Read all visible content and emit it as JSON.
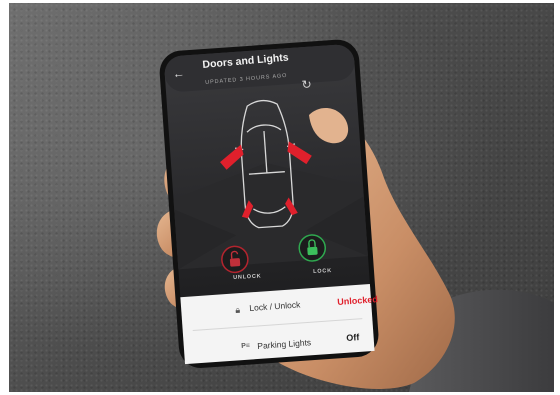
{
  "app": {
    "back_icon": "←",
    "title": "Doors and Lights",
    "updated_text": "UPDATED 3 HOURS AGO",
    "refresh_icon": "↻"
  },
  "controls": {
    "unlock_label": "UNLOCK",
    "lock_label": "LOCK"
  },
  "status_rows": [
    {
      "icon": "lock-icon",
      "label": "Lock / Unlock",
      "value": "Unlocked"
    },
    {
      "icon": "parking-lights-icon",
      "label": "Parking Lights",
      "value": "Off"
    }
  ],
  "colors": {
    "accent_red": "#e0202c",
    "screen_bg": "#2a2a2c",
    "unlock_button": "#b3242e",
    "lock_button": "#2fa84f"
  }
}
